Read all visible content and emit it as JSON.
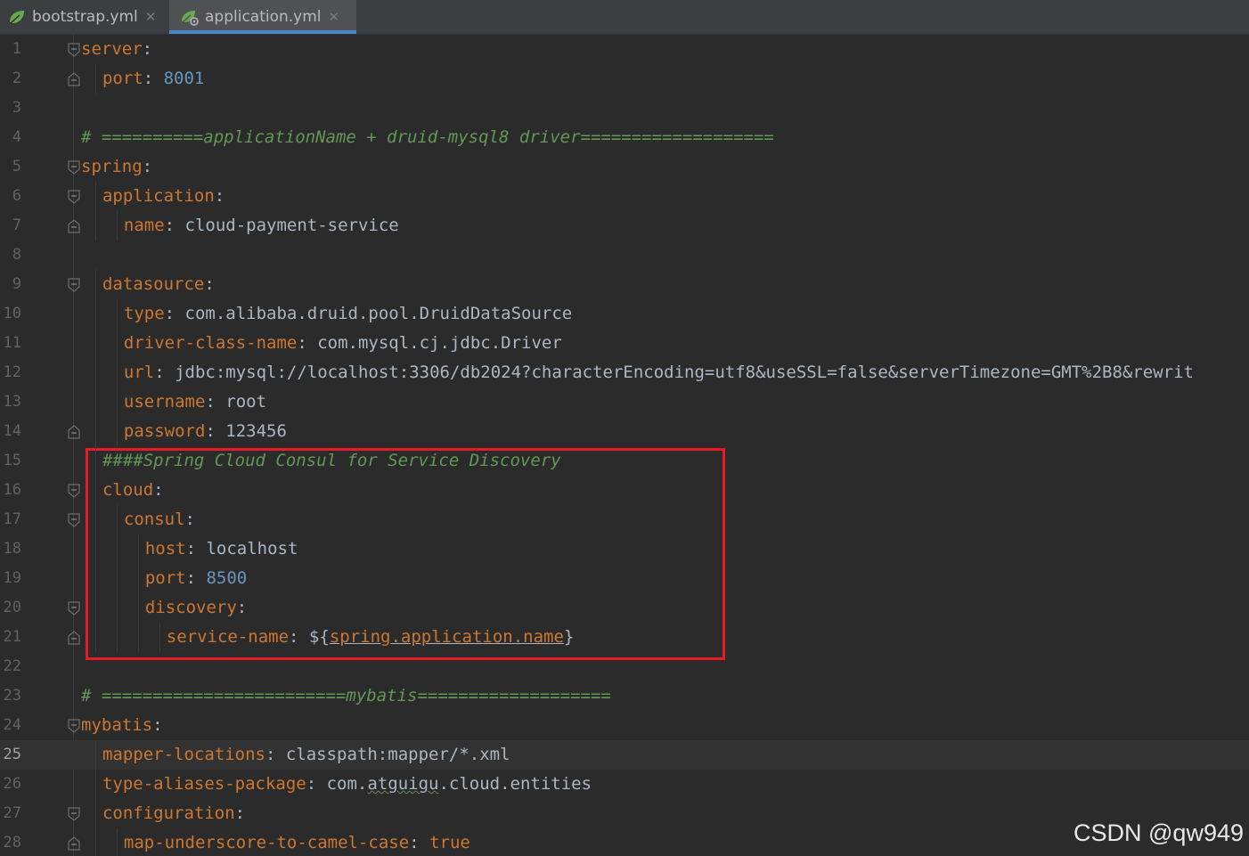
{
  "tabs": [
    {
      "label": "bootstrap.yml",
      "close": "✕",
      "active": false
    },
    {
      "label": "application.yml",
      "close": "✕",
      "active": true
    }
  ],
  "lines": [
    {
      "num": "1",
      "fold": "start",
      "indent": 0,
      "tokens": [
        {
          "t": "server",
          "c": "k"
        },
        {
          "t": ":",
          "c": "p"
        }
      ]
    },
    {
      "num": "2",
      "fold": "end",
      "indent": 1,
      "tokens": [
        {
          "t": "port",
          "c": "k"
        },
        {
          "t": ": ",
          "c": "p"
        },
        {
          "t": "8001",
          "c": "n"
        }
      ]
    },
    {
      "num": "3",
      "indent": 0,
      "tokens": []
    },
    {
      "num": "4",
      "indent": 0,
      "tokens": [
        {
          "t": "# ==========applicationName + druid-mysql8 driver===================",
          "c": "c"
        }
      ]
    },
    {
      "num": "5",
      "fold": "start",
      "indent": 0,
      "tokens": [
        {
          "t": "spring",
          "c": "k"
        },
        {
          "t": ":",
          "c": "p"
        }
      ]
    },
    {
      "num": "6",
      "fold": "start",
      "indent": 1,
      "tokens": [
        {
          "t": "application",
          "c": "k"
        },
        {
          "t": ":",
          "c": "p"
        }
      ]
    },
    {
      "num": "7",
      "fold": "end",
      "indent": 2,
      "tokens": [
        {
          "t": "name",
          "c": "k"
        },
        {
          "t": ": ",
          "c": "p"
        },
        {
          "t": "cloud-payment-service",
          "c": "s"
        }
      ]
    },
    {
      "num": "8",
      "indent": 0,
      "tokens": []
    },
    {
      "num": "9",
      "fold": "start",
      "indent": 1,
      "tokens": [
        {
          "t": "datasource",
          "c": "k"
        },
        {
          "t": ":",
          "c": "p"
        }
      ]
    },
    {
      "num": "10",
      "indent": 2,
      "tokens": [
        {
          "t": "type",
          "c": "k"
        },
        {
          "t": ": ",
          "c": "p"
        },
        {
          "t": "com.alibaba.druid.pool.DruidDataSource",
          "c": "s"
        }
      ]
    },
    {
      "num": "11",
      "indent": 2,
      "tokens": [
        {
          "t": "driver-class-name",
          "c": "k"
        },
        {
          "t": ": ",
          "c": "p"
        },
        {
          "t": "com.mysql.cj.jdbc.Driver",
          "c": "s"
        }
      ]
    },
    {
      "num": "12",
      "indent": 2,
      "tokens": [
        {
          "t": "url",
          "c": "k"
        },
        {
          "t": ": ",
          "c": "p"
        },
        {
          "t": "jdbc:mysql://localhost:3306/db2024?characterEncoding=utf8&useSSL=false&serverTimezone=GMT%2B8&rewrit",
          "c": "s"
        }
      ]
    },
    {
      "num": "13",
      "indent": 2,
      "tokens": [
        {
          "t": "username",
          "c": "k"
        },
        {
          "t": ": ",
          "c": "p"
        },
        {
          "t": "root",
          "c": "s"
        }
      ]
    },
    {
      "num": "14",
      "fold": "end",
      "indent": 2,
      "tokens": [
        {
          "t": "password",
          "c": "k"
        },
        {
          "t": ": ",
          "c": "p"
        },
        {
          "t": "123456",
          "c": "s"
        }
      ]
    },
    {
      "num": "15",
      "indent": 1,
      "tokens": [
        {
          "t": "####Spring Cloud Consul for Service Discovery",
          "c": "c"
        }
      ]
    },
    {
      "num": "16",
      "fold": "start",
      "indent": 1,
      "tokens": [
        {
          "t": "cloud",
          "c": "k"
        },
        {
          "t": ":",
          "c": "p"
        }
      ]
    },
    {
      "num": "17",
      "fold": "start",
      "indent": 2,
      "tokens": [
        {
          "t": "consul",
          "c": "k"
        },
        {
          "t": ":",
          "c": "p"
        }
      ]
    },
    {
      "num": "18",
      "indent": 3,
      "tokens": [
        {
          "t": "host",
          "c": "k"
        },
        {
          "t": ": ",
          "c": "p"
        },
        {
          "t": "localhost",
          "c": "s"
        }
      ]
    },
    {
      "num": "19",
      "indent": 3,
      "tokens": [
        {
          "t": "port",
          "c": "k"
        },
        {
          "t": ": ",
          "c": "p"
        },
        {
          "t": "8500",
          "c": "n"
        }
      ]
    },
    {
      "num": "20",
      "fold": "start",
      "indent": 3,
      "tokens": [
        {
          "t": "discovery",
          "c": "k"
        },
        {
          "t": ":",
          "c": "p"
        }
      ]
    },
    {
      "num": "21",
      "fold": "end",
      "indent": 4,
      "tokens": [
        {
          "t": "service-name",
          "c": "k"
        },
        {
          "t": ": ",
          "c": "p"
        },
        {
          "t": "${",
          "c": "s"
        },
        {
          "t": "spring.application.name",
          "c": "k u"
        },
        {
          "t": "}",
          "c": "s"
        }
      ]
    },
    {
      "num": "22",
      "indent": 0,
      "tokens": []
    },
    {
      "num": "23",
      "indent": 0,
      "tokens": [
        {
          "t": "# ========================mybatis===================",
          "c": "c"
        }
      ]
    },
    {
      "num": "24",
      "fold": "start",
      "indent": 0,
      "tokens": [
        {
          "t": "mybatis",
          "c": "k"
        },
        {
          "t": ":",
          "c": "p"
        }
      ]
    },
    {
      "num": "25",
      "current": true,
      "indent": 1,
      "tokens": [
        {
          "t": "mapper-locations",
          "c": "k"
        },
        {
          "t": ": ",
          "c": "p"
        },
        {
          "t": "classpath:mapper/*.xml",
          "c": "s"
        }
      ]
    },
    {
      "num": "26",
      "indent": 1,
      "tokens": [
        {
          "t": "type-aliases-package",
          "c": "k"
        },
        {
          "t": ": ",
          "c": "p"
        },
        {
          "t": "com.",
          "c": "s"
        },
        {
          "t": "atguigu",
          "c": "s w"
        },
        {
          "t": ".cloud.entities",
          "c": "s"
        }
      ]
    },
    {
      "num": "27",
      "fold": "start",
      "indent": 1,
      "tokens": [
        {
          "t": "configuration",
          "c": "k"
        },
        {
          "t": ":",
          "c": "p"
        }
      ]
    },
    {
      "num": "28",
      "fold": "end",
      "indent": 2,
      "tokens": [
        {
          "t": "map-underscore-to-camel-case",
          "c": "k"
        },
        {
          "t": ": ",
          "c": "p"
        },
        {
          "t": "true",
          "c": "k"
        }
      ]
    }
  ],
  "watermark": "CSDN @qw949",
  "colors": {
    "background": "#2b2b2b",
    "key": "#cc7832",
    "number": "#6897bb",
    "comment": "#629755",
    "text": "#a9b7c6",
    "highlight_border": "#e81a24",
    "tab_underline": "#4a88c7"
  },
  "icons": {
    "tab_file": "spring-leaf-icon",
    "fold": "fold-marker-icon"
  }
}
